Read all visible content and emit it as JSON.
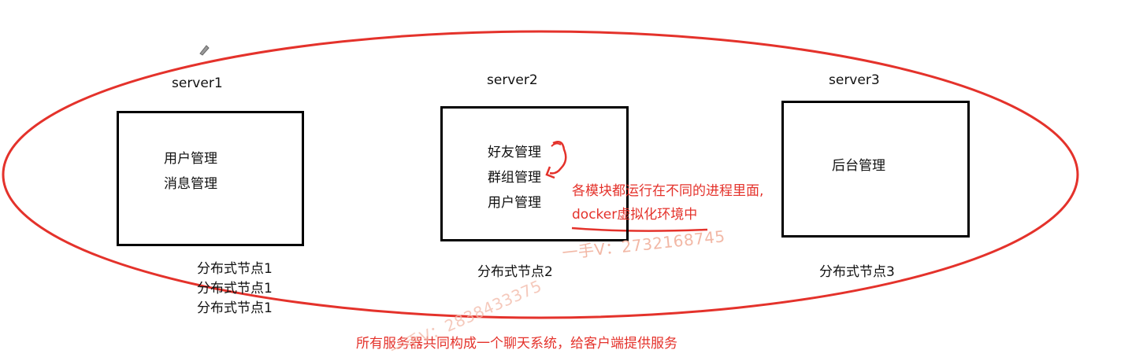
{
  "servers": [
    {
      "name": "server1",
      "modules": [
        "用户管理",
        "消息管理"
      ],
      "nodes": [
        "分布式节点1",
        "分布式节点1",
        "分布式节点1"
      ]
    },
    {
      "name": "server2",
      "modules": [
        "好友管理",
        "群组管理",
        "用户管理"
      ],
      "nodes": [
        "分布式节点2"
      ]
    },
    {
      "name": "server3",
      "modules": [
        "后台管理"
      ],
      "nodes": [
        "分布式节点3"
      ]
    }
  ],
  "annotation": {
    "line1": "各模块都运行在不同的进程里面,",
    "line2": "docker虚拟化环境中"
  },
  "summary": "所有服务器共同构成一个聊天系统，给客户端提供服务",
  "watermark1": "一手V：2732168745",
  "watermark2": "一手V：2838433375",
  "colors": {
    "annotation": "#e4322b",
    "box": "#000000",
    "watermark": "#f2b8a6"
  }
}
